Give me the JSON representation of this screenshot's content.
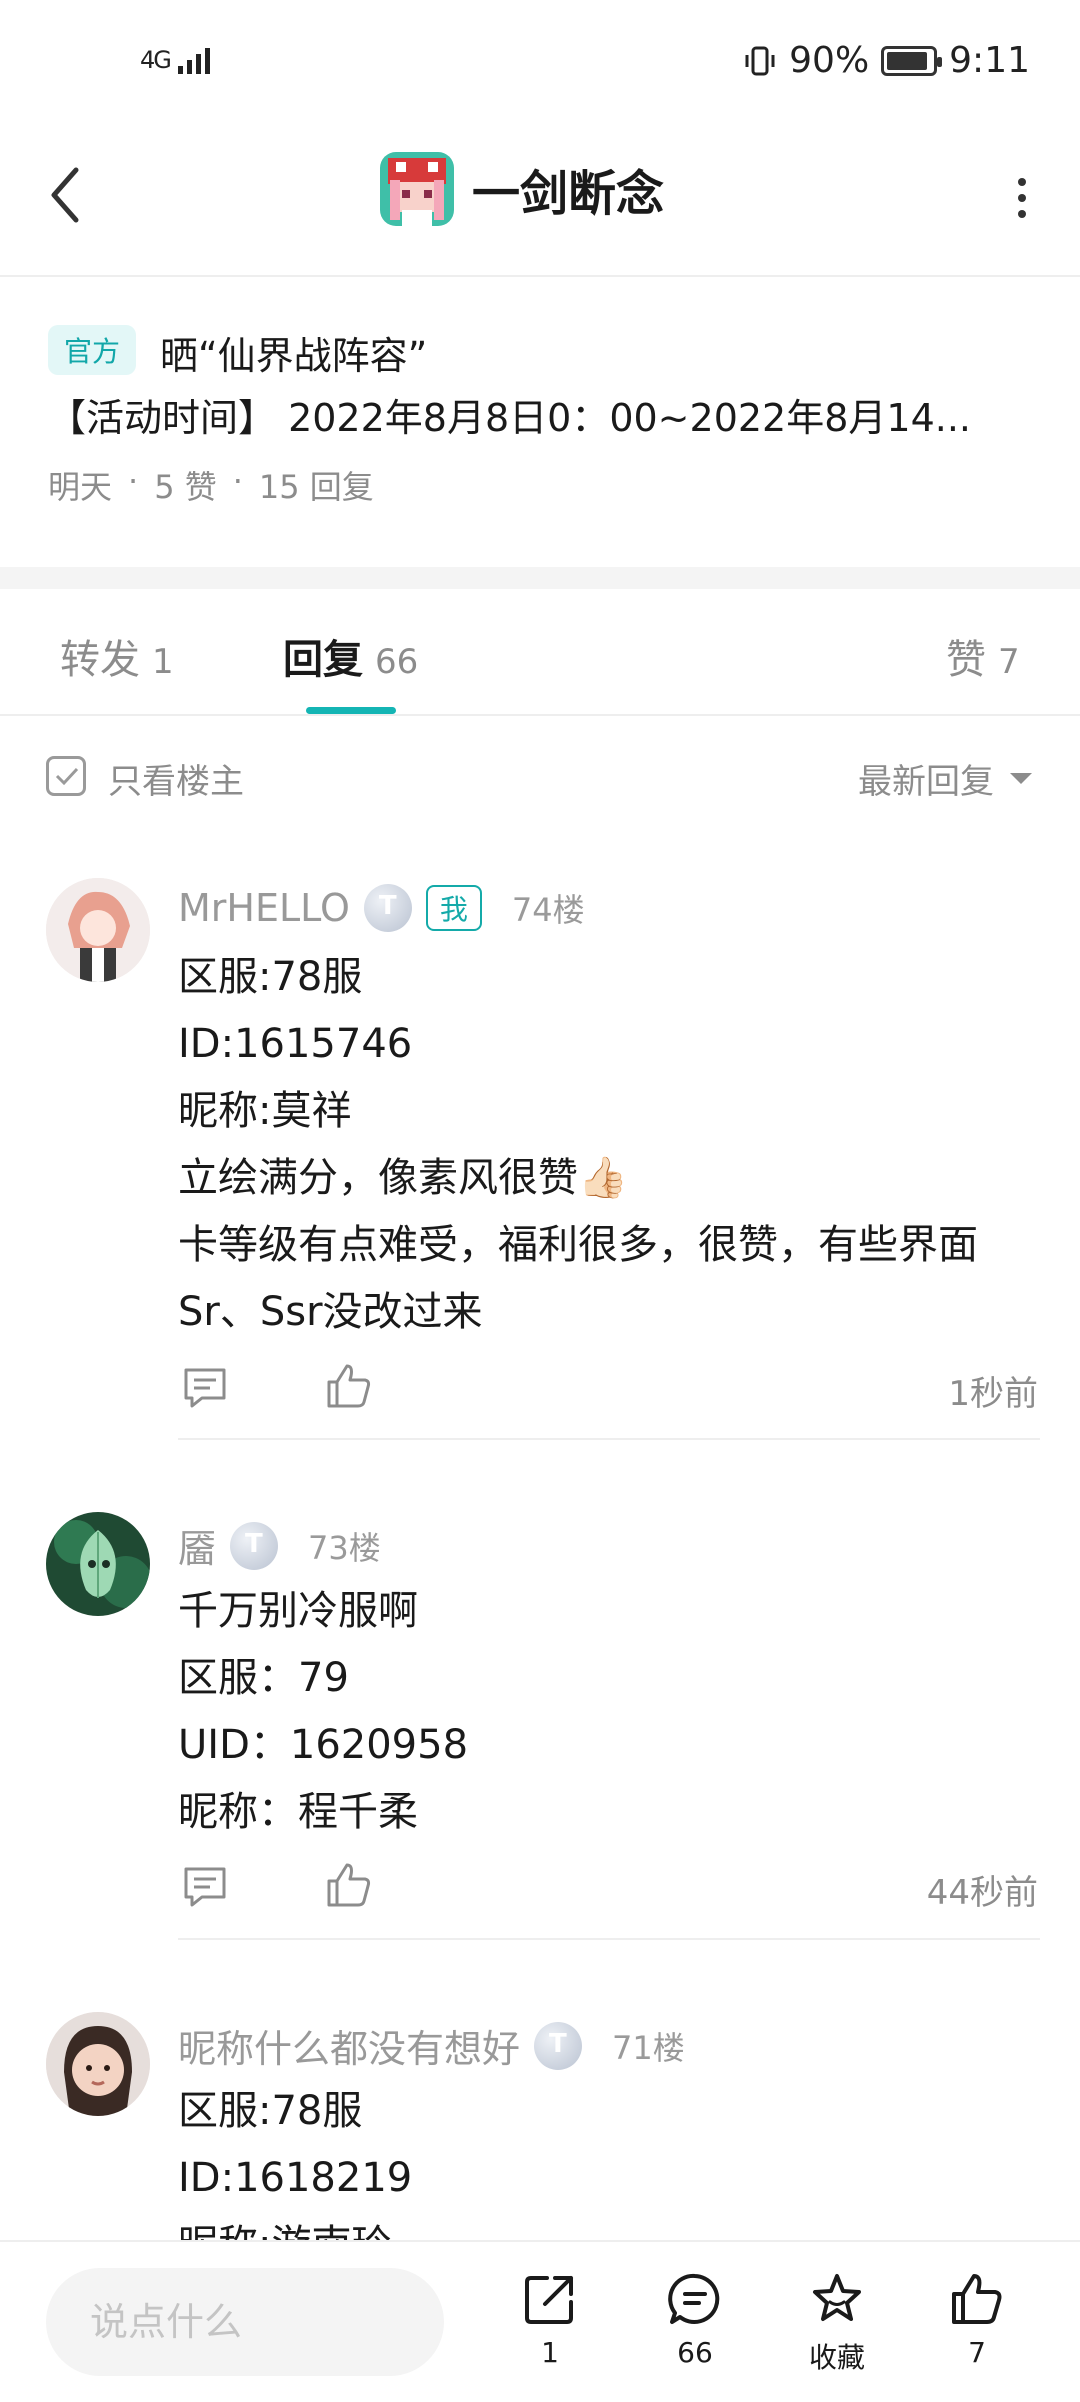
{
  "status_bar": {
    "network": "4G",
    "battery_percent": "90%",
    "battery_level": 0.9,
    "time": "9:11"
  },
  "nav": {
    "game_name": "一剑断念"
  },
  "post": {
    "official_badge": "官方",
    "title": "晒“仙界战阵容”",
    "excerpt": "【活动时间】 2022年8月8日0：00~2022年8月14...",
    "meta": {
      "date": "明天",
      "sep1": "·",
      "likes": "5 赞",
      "sep2": "·",
      "replies": "15 回复"
    }
  },
  "tabs": [
    {
      "label": "转发",
      "count": "1"
    },
    {
      "label": "回复",
      "count": "66"
    },
    {
      "label": "赞",
      "count": "7"
    }
  ],
  "filter": {
    "only_author_label": "只看楼主",
    "sort_label": "最新回复"
  },
  "comments": [
    {
      "name": "MrHELLO",
      "level": "T",
      "me_tag": "我",
      "floor": "74楼",
      "lines": [
        "区服:78服",
        "ID:1615746",
        "昵称:莫祥",
        "立绘满分，像素风很赞👍🏻",
        "卡等级有点难受，福利很多，很赞，有些界面",
        "Sr、Ssr没改过来"
      ],
      "time": "1秒前"
    },
    {
      "name": "靥",
      "level": "T",
      "floor": "73楼",
      "lines": [
        "千万别冷服啊",
        "区服：79",
        "UID：1620958",
        "昵称：程千柔"
      ],
      "time": "44秒前"
    },
    {
      "name": "昵称什么都没有想好",
      "level": "T",
      "floor": "71楼",
      "lines": [
        "区服:78服",
        "ID:1618219",
        "昵称:游南玲"
      ]
    }
  ],
  "bottom_bar": {
    "input_placeholder": "说点什么",
    "share_count": "1",
    "comment_count": "66",
    "favorite_label": "收藏",
    "like_count": "7"
  },
  "colors": {
    "accent": "#14b5b4",
    "muted_text": "#8c8c8c"
  }
}
